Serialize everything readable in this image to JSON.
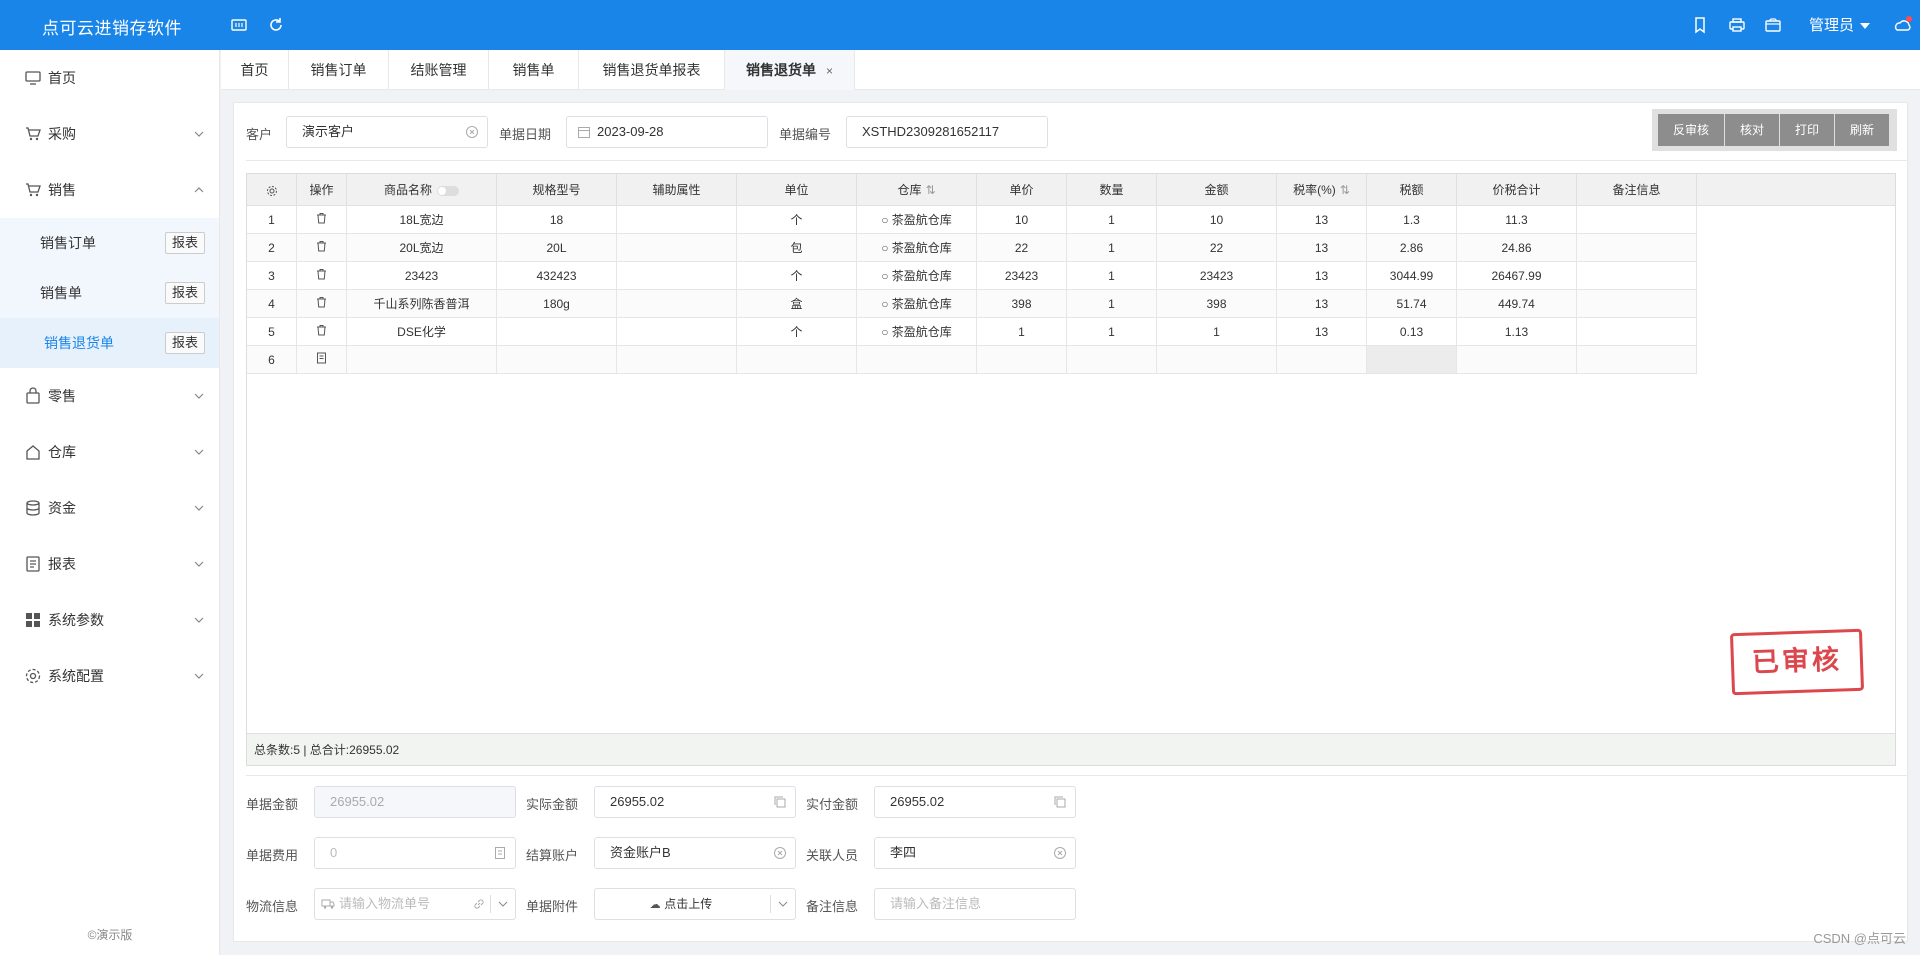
{
  "app": {
    "title": "点可云进销存软件",
    "user": "管理员"
  },
  "sidebar": {
    "items": [
      {
        "label": "首页",
        "icon": "monitor-icon"
      },
      {
        "label": "采购",
        "icon": "cart-icon"
      },
      {
        "label": "销售",
        "icon": "cart-icon"
      }
    ],
    "sales_sub": [
      {
        "label": "销售订单",
        "report": "报表"
      },
      {
        "label": "销售单",
        "report": "报表"
      },
      {
        "label": "销售退货单",
        "report": "报表"
      }
    ],
    "items2": [
      {
        "label": "零售"
      },
      {
        "label": "仓库"
      },
      {
        "label": "资金"
      },
      {
        "label": "报表"
      },
      {
        "label": "系统参数"
      },
      {
        "label": "系统配置"
      }
    ],
    "demo": "©演示版"
  },
  "tabs": [
    {
      "label": "首页"
    },
    {
      "label": "销售订单"
    },
    {
      "label": "结账管理"
    },
    {
      "label": "销售单"
    },
    {
      "label": "销售退货单报表"
    },
    {
      "label": "销售退货单",
      "close": "×"
    }
  ],
  "form": {
    "customer_label": "客户",
    "customer_value": "演示客户",
    "date_label": "单据日期",
    "date_value": "2023-09-28",
    "number_label": "单据编号",
    "number_value": "XSTHD2309281652117"
  },
  "actions": [
    "反审核",
    "核对",
    "打印",
    "刷新"
  ],
  "grid": {
    "headers": [
      "操作",
      "商品名称",
      "规格型号",
      "辅助属性",
      "单位",
      "仓库",
      "单价",
      "数量",
      "金额",
      "税率(%)",
      "税额",
      "价税合计",
      "备注信息"
    ],
    "rows": [
      {
        "no": "1",
        "name": "18L宽边",
        "spec": "18",
        "attr": "",
        "unit": "个",
        "wh": "茶盈航仓库",
        "price": "10",
        "qty": "1",
        "amount": "10",
        "rate": "13",
        "tax": "1.3",
        "total": "11.3",
        "note": ""
      },
      {
        "no": "2",
        "name": "20L宽边",
        "spec": "20L",
        "attr": "",
        "unit": "包",
        "wh": "茶盈航仓库",
        "price": "22",
        "qty": "1",
        "amount": "22",
        "rate": "13",
        "tax": "2.86",
        "total": "24.86",
        "note": ""
      },
      {
        "no": "3",
        "name": "23423",
        "spec": "432423",
        "attr": "",
        "unit": "个",
        "wh": "茶盈航仓库",
        "price": "23423",
        "qty": "1",
        "amount": "23423",
        "rate": "13",
        "tax": "3044.99",
        "total": "26467.99",
        "note": ""
      },
      {
        "no": "4",
        "name": "千山系列陈香普洱",
        "spec": "180g",
        "attr": "",
        "unit": "盒",
        "wh": "茶盈航仓库",
        "price": "398",
        "qty": "1",
        "amount": "398",
        "rate": "13",
        "tax": "51.74",
        "total": "449.74",
        "note": ""
      },
      {
        "no": "5",
        "name": "DSE化学",
        "spec": "",
        "attr": "",
        "unit": "个",
        "wh": "茶盈航仓库",
        "price": "1",
        "qty": "1",
        "amount": "1",
        "rate": "13",
        "tax": "0.13",
        "total": "1.13",
        "note": ""
      }
    ],
    "new_row_no": "6",
    "footer": "总条数:5 | 总合计:26955.02"
  },
  "stamp": "已审核",
  "bottom": {
    "doc_amount_label": "单据金额",
    "doc_amount": "26955.02",
    "actual_amount_label": "实际金额",
    "actual_amount": "26955.02",
    "paid_amount_label": "实付金额",
    "paid_amount": "26955.02",
    "doc_fee_label": "单据费用",
    "doc_fee": "0",
    "account_label": "结算账户",
    "account": "资金账户B",
    "person_label": "关联人员",
    "person": "李四",
    "logistics_label": "物流信息",
    "logistics_ph": "请输入物流单号",
    "attach_label": "单据附件",
    "attach": "点击上传",
    "note_label": "备注信息",
    "note_ph": "请输入备注信息"
  },
  "watermark": "CSDN @点可云"
}
